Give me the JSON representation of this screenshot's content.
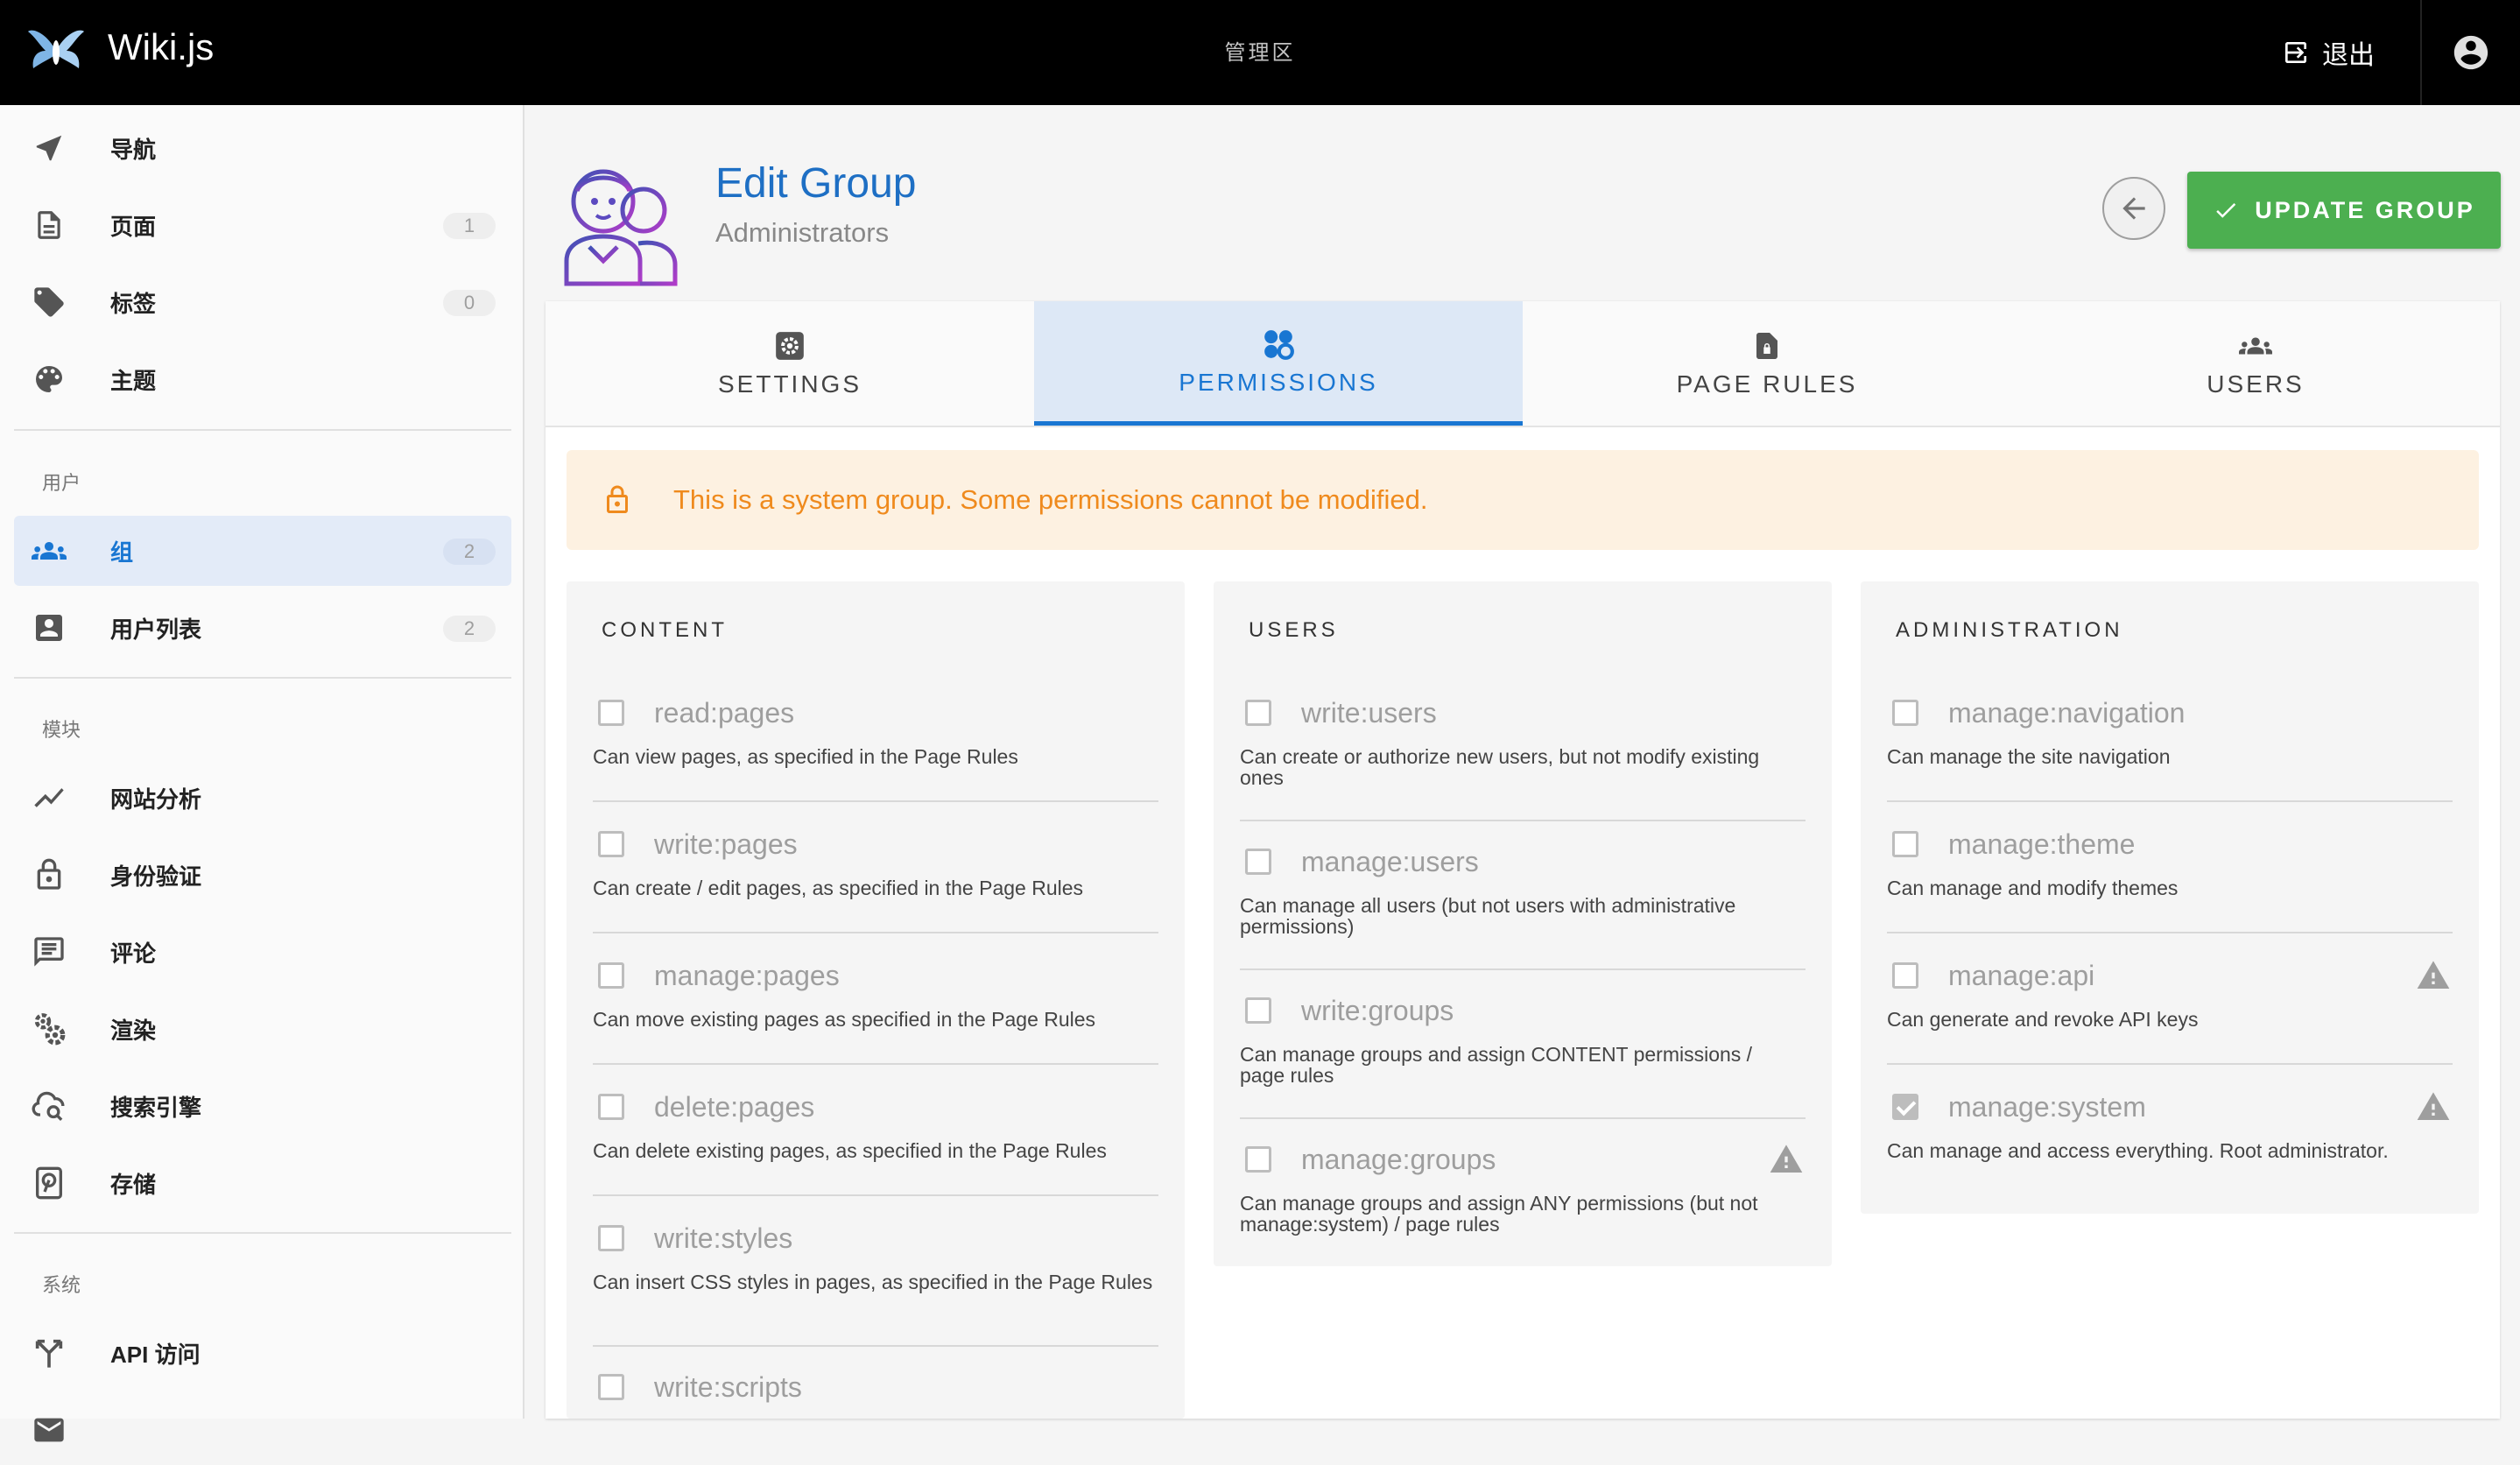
{
  "app": {
    "name": "Wiki.js",
    "section": "管理区",
    "logout_label": "退出"
  },
  "colors": {
    "accent": "#1976d2",
    "success": "#4caf50",
    "warning_text": "#ef8a1d",
    "warning_bg": "#fdf1e1",
    "topbar": "#000000"
  },
  "sidebar": {
    "items": [
      {
        "label": "导航",
        "icon": "navigation-icon"
      },
      {
        "label": "页面",
        "icon": "page-icon",
        "badge": "1"
      },
      {
        "label": "标签",
        "icon": "tags-icon",
        "badge": "0"
      },
      {
        "label": "主题",
        "icon": "palette-icon"
      },
      {
        "label": "组",
        "icon": "groups-icon",
        "badge": "2",
        "active": true
      },
      {
        "label": "用户列表",
        "icon": "user-box-icon",
        "badge": "2"
      },
      {
        "label": "网站分析",
        "icon": "analytics-icon"
      },
      {
        "label": "身份验证",
        "icon": "lock-icon"
      },
      {
        "label": "评论",
        "icon": "comment-icon"
      },
      {
        "label": "渲染",
        "icon": "cogs-icon"
      },
      {
        "label": "搜索引擎",
        "icon": "search-cloud-icon"
      },
      {
        "label": "存储",
        "icon": "storage-icon"
      },
      {
        "label": "API 访问",
        "icon": "api-icon"
      }
    ],
    "sections": {
      "users": "用户",
      "modules": "模块",
      "system": "系统"
    }
  },
  "header": {
    "title": "Edit Group",
    "subtitle": "Administrators",
    "update_label": "UPDATE GROUP"
  },
  "tabs": [
    {
      "label": "SETTINGS",
      "icon": "settings-icon"
    },
    {
      "label": "PERMISSIONS",
      "icon": "permissions-icon",
      "active": true
    },
    {
      "label": "PAGE RULES",
      "icon": "page-rules-icon"
    },
    {
      "label": "USERS",
      "icon": "users-icon"
    }
  ],
  "alert": {
    "text": "This is a system group. Some permissions cannot be modified."
  },
  "columns": [
    {
      "title": "CONTENT",
      "perms": [
        {
          "name": "read:pages",
          "desc": "Can view pages, as specified in the Page Rules",
          "checked": false
        },
        {
          "name": "write:pages",
          "desc": "Can create / edit pages, as specified in the Page Rules",
          "checked": false
        },
        {
          "name": "manage:pages",
          "desc": "Can move existing pages as specified in the Page Rules",
          "checked": false
        },
        {
          "name": "delete:pages",
          "desc": "Can delete existing pages, as specified in the Page Rules",
          "checked": false
        },
        {
          "name": "write:styles",
          "desc": "Can insert CSS styles in pages, as specified in the Page Rules",
          "checked": false
        },
        {
          "name": "write:scripts",
          "desc": "",
          "checked": false
        }
      ]
    },
    {
      "title": "USERS",
      "perms": [
        {
          "name": "write:users",
          "desc": "Can create or authorize new users, but not modify existing ones",
          "checked": false
        },
        {
          "name": "manage:users",
          "desc": "Can manage all users (but not users with administrative permissions)",
          "checked": false
        },
        {
          "name": "write:groups",
          "desc": "Can manage groups and assign CONTENT permissions / page rules",
          "checked": false
        },
        {
          "name": "manage:groups",
          "desc": "Can manage groups and assign ANY permissions (but not manage:system) / page rules",
          "checked": false,
          "warning": true
        }
      ]
    },
    {
      "title": "ADMINISTRATION",
      "perms": [
        {
          "name": "manage:navigation",
          "desc": "Can manage the site navigation",
          "checked": false
        },
        {
          "name": "manage:theme",
          "desc": "Can manage and modify themes",
          "checked": false
        },
        {
          "name": "manage:api",
          "desc": "Can generate and revoke API keys",
          "checked": false,
          "warning": true
        },
        {
          "name": "manage:system",
          "desc": "Can manage and access everything. Root administrator.",
          "checked": true,
          "warning": true
        }
      ]
    }
  ]
}
